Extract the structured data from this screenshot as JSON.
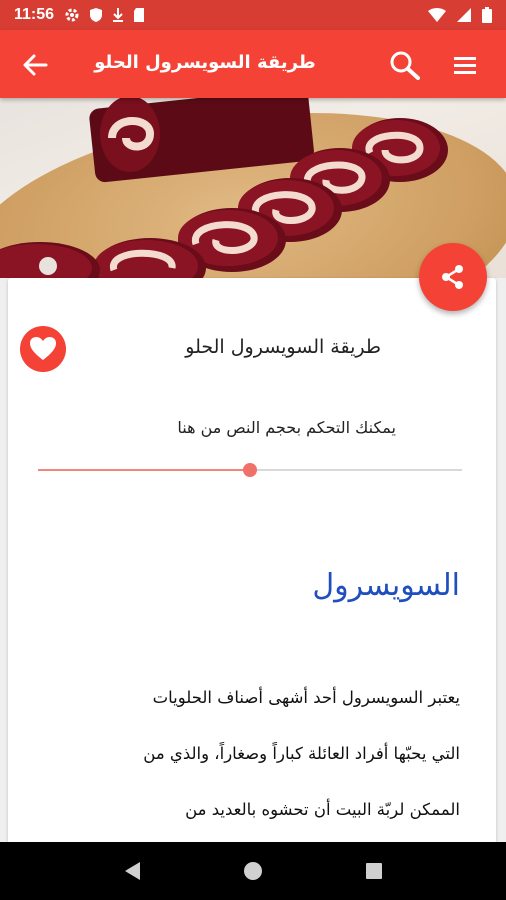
{
  "status_bar": {
    "time": "11:56",
    "left_icons": [
      "gear-icon",
      "shield-icon",
      "download-icon",
      "sd-card-icon"
    ],
    "right_icons": [
      "wifi-icon",
      "cell-signal-icon",
      "battery-icon"
    ]
  },
  "app_bar": {
    "title": "طريقة السويسرول الحلو",
    "background": "#f44336"
  },
  "content": {
    "card_title": "طريقة السويسرول الحلو",
    "font_size_hint": "يمكنك التحكم بحجم النص من هنا",
    "font_slider": {
      "value": 0.5
    },
    "heading": "السويسرول",
    "paragraph_lines": [
      "يعتبر السويسرول أحد أشهى أصناف الحلويات",
      "التي يحبّها أفراد العائلة كباراً وصغاراً، والذي من",
      "الممكن لربّة البيت أن تحشوه بالعديد من"
    ]
  },
  "colors": {
    "accent": "#f44336",
    "status": "#d73d33",
    "heading": "#1f4fbf"
  }
}
